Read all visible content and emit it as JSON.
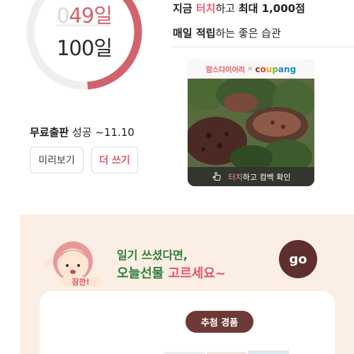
{
  "counter": {
    "current_prefix": "0",
    "current": "49일",
    "total": "100일",
    "progress": 0.49,
    "ring_color": "#d2636d"
  },
  "status": {
    "bold": "무료출판",
    "rest": " 성공 ~11.10"
  },
  "buttons": {
    "preview": "미리보기",
    "write": "더 쓰기"
  },
  "headline": {
    "line1_a": "지금 ",
    "line1_accent": "터치",
    "line1_b": "하고 ",
    "line1_c": "최대 1,000점",
    "line2_a": "매일 적립",
    "line2_b": "하는 좋은 습관"
  },
  "ad": {
    "brand": "맘스다이어리",
    "x": "×",
    "partner": "coupang",
    "footer_accent": "터치",
    "footer_rest": "하고 컴백 확인",
    "hand_icon": "touch-hand-icon"
  },
  "promo": {
    "mascot_badge": "잠깐!",
    "line1": "일기 쓰셨다면,",
    "line2_a": "오늘선물 ",
    "line2_accent": "고르세요~",
    "go": "go",
    "prize_label": "추첨 경품"
  },
  "colors": {
    "accent_pink": "#e0566a",
    "promo_bg": "#fbeee4",
    "promo_green": "#2f7d3b",
    "brown": "#6e3a37"
  }
}
